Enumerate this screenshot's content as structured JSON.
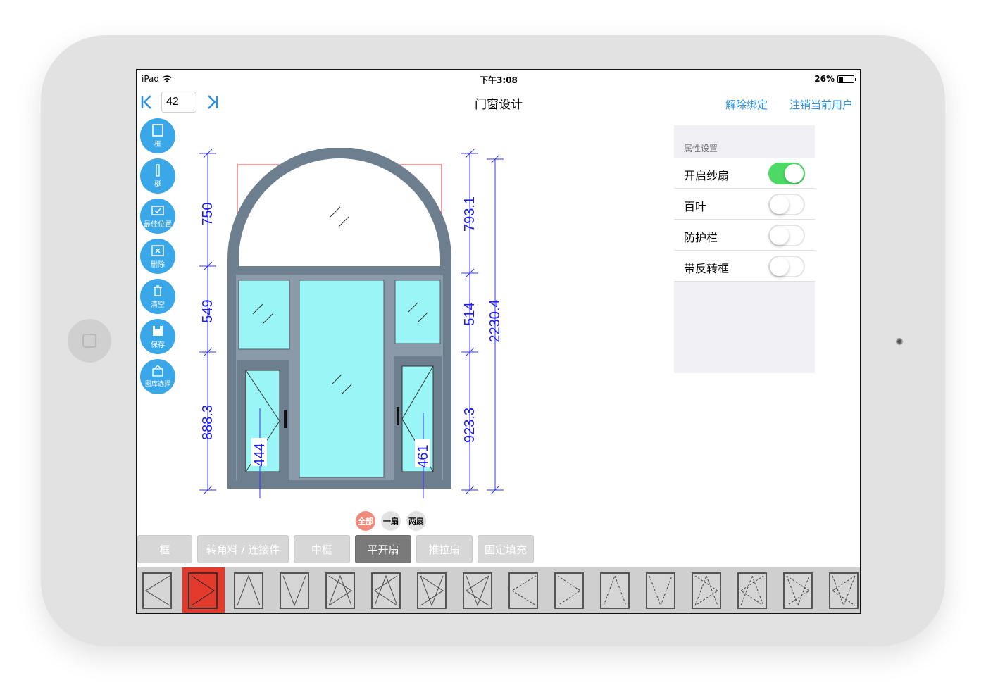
{
  "status_bar": {
    "device": "iPad",
    "time": "下午3:08",
    "battery": "26%"
  },
  "nav": {
    "page_number": "42",
    "title": "门窗设计",
    "unbind_label": "解除绑定",
    "logout_label": "注销当前用户"
  },
  "tools": [
    {
      "label": "框",
      "icon": "frame-icon"
    },
    {
      "label": "梃",
      "icon": "mullion-icon"
    },
    {
      "label": "最佳位置",
      "icon": "best-position-icon"
    },
    {
      "label": "删除",
      "icon": "delete-icon"
    },
    {
      "label": "清空",
      "icon": "trash-icon"
    },
    {
      "label": "保存",
      "icon": "save-icon"
    },
    {
      "label": "图库选择",
      "icon": "gallery-icon"
    }
  ],
  "drawing": {
    "dims_left": [
      "750",
      "549",
      "888.3"
    ],
    "dims_right": [
      "793.1",
      "514",
      "923.3"
    ],
    "dim_total": "2230.4",
    "dim_sash_left": "444",
    "dim_sash_right": "461"
  },
  "filters": [
    "全部",
    "一扇",
    "两扇"
  ],
  "tabs": [
    "框",
    "转角料 / 连接件",
    "中梃",
    "平开扇",
    "推拉扇",
    "固定填充"
  ],
  "active_tab": "平开扇",
  "properties": {
    "header": "属性设置",
    "rows": [
      {
        "label": "开启纱扇",
        "on": true
      },
      {
        "label": "百叶",
        "on": false
      },
      {
        "label": "防护栏",
        "on": false
      },
      {
        "label": "带反转框",
        "on": false
      }
    ]
  },
  "colors": {
    "accent": "#2b8fe3",
    "tool_bg": "#3aa7e8",
    "frame": "#6d7f8f",
    "glass": "#9af6f6",
    "dimension": "#1a1aff",
    "toggle_on": "#4cd964",
    "selected_thumb": "#e23b2e"
  }
}
